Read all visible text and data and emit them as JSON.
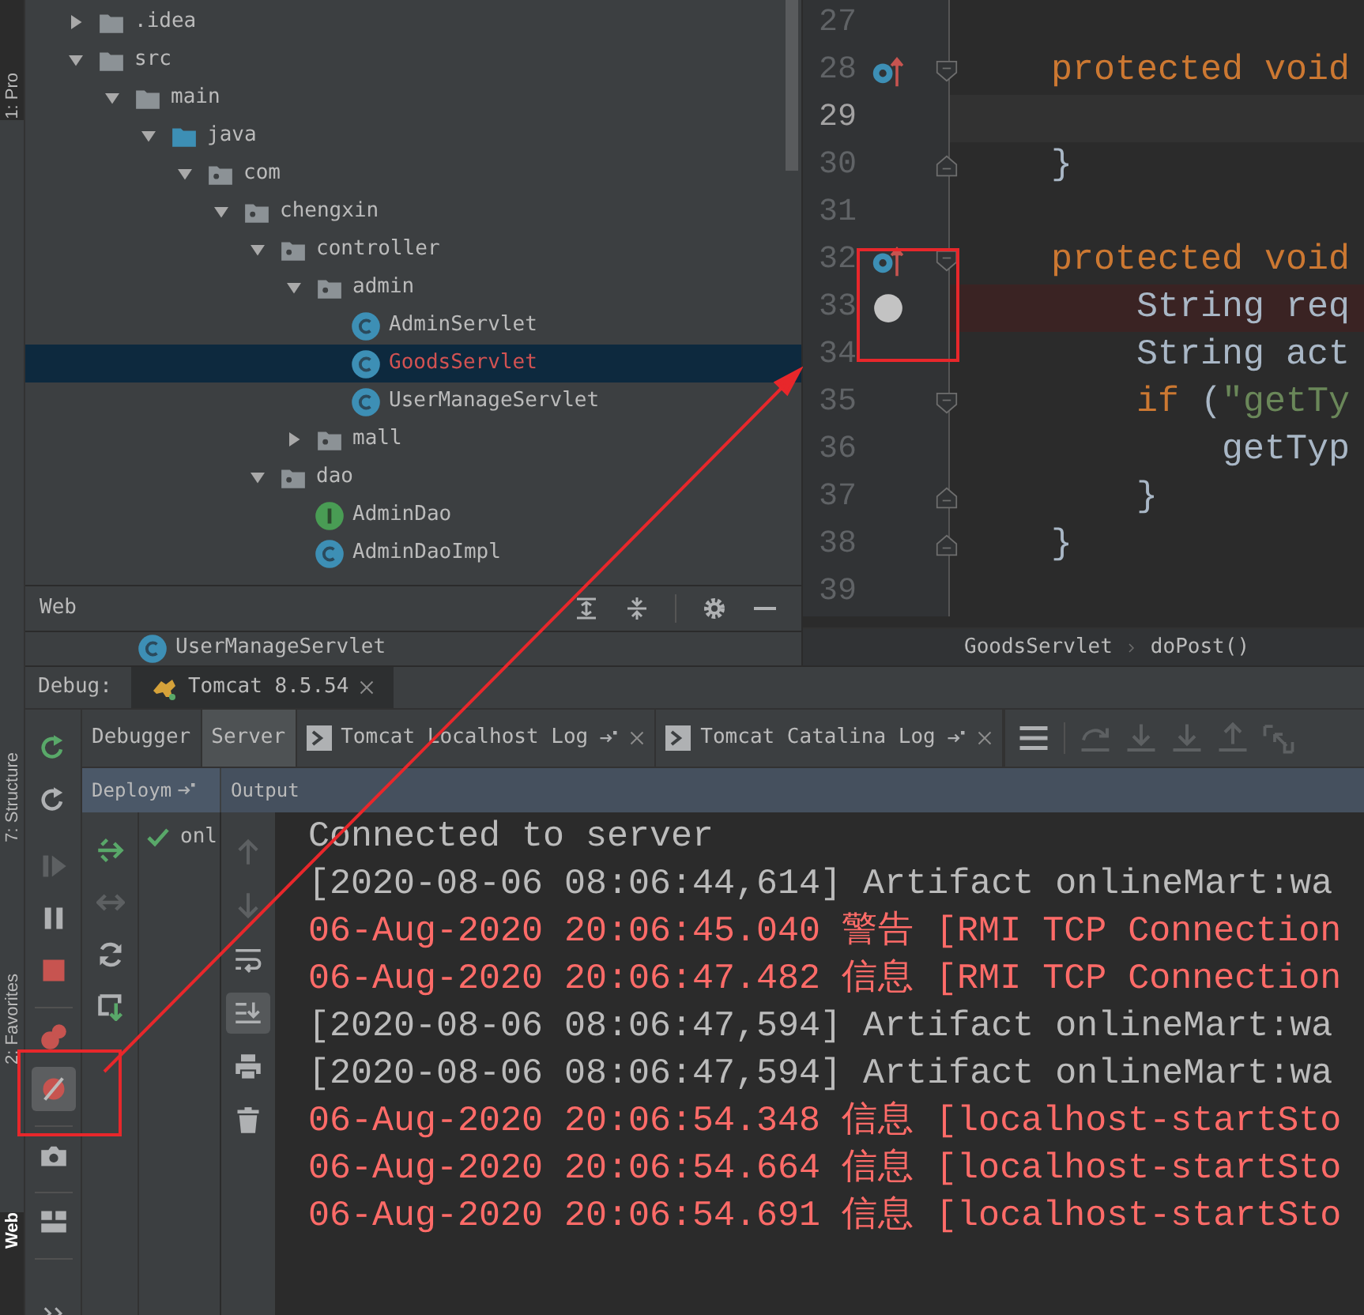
{
  "left_stripe": [
    {
      "label": "1: Pro",
      "selected": false
    },
    {
      "label": "7: Structure",
      "selected": false
    },
    {
      "label": "2: Favorites",
      "selected": false
    },
    {
      "label": "Web",
      "selected": true
    }
  ],
  "project_tree": [
    {
      "kind": "folder",
      "label": ".idea",
      "expanded": false,
      "selected": false
    },
    {
      "kind": "folder",
      "label": "src",
      "expanded": true,
      "selected": false,
      "children": [
        {
          "kind": "folder",
          "label": "main",
          "expanded": true,
          "selected": false,
          "children": [
            {
              "kind": "source_folder",
              "label": "java",
              "expanded": true,
              "selected": false,
              "children": [
                {
                  "kind": "package",
                  "label": "com",
                  "expanded": true,
                  "selected": false,
                  "children": [
                    {
                      "kind": "package",
                      "label": "chengxin",
                      "expanded": true,
                      "selected": false,
                      "children": [
                        {
                          "kind": "package",
                          "label": "controller",
                          "expanded": true,
                          "selected": false,
                          "children": [
                            {
                              "kind": "package",
                              "label": "admin",
                              "expanded": true,
                              "selected": false,
                              "children": [
                                {
                                  "kind": "class",
                                  "label": "AdminServlet",
                                  "selected": false,
                                  "color": "#bbbbbb"
                                },
                                {
                                  "kind": "class",
                                  "label": "GoodsServlet",
                                  "selected": true,
                                  "color": "#d25252"
                                },
                                {
                                  "kind": "class",
                                  "label": "UserManageServlet",
                                  "selected": false,
                                  "color": "#bbbbbb"
                                }
                              ]
                            },
                            {
                              "kind": "package",
                              "label": "mall",
                              "expanded": false,
                              "selected": false
                            }
                          ]
                        },
                        {
                          "kind": "package",
                          "label": "dao",
                          "expanded": true,
                          "selected": false,
                          "children": [
                            {
                              "kind": "interface",
                              "label": "AdminDao",
                              "selected": false,
                              "color": "#bbbbbb"
                            },
                            {
                              "kind": "class",
                              "label": "AdminDaoImpl",
                              "selected": false,
                              "color": "#bbbbbb"
                            }
                          ]
                        }
                      ]
                    }
                  ]
                }
              ]
            }
          ]
        }
      ]
    }
  ],
  "web_panel": {
    "title": "Web",
    "items": [
      {
        "kind": "class",
        "label": "UserManageServlet"
      }
    ]
  },
  "editor": {
    "lines": [
      {
        "number": "27",
        "current": false,
        "breakpoint_line": false
      },
      {
        "number": "28",
        "current": false,
        "breakpoint_line": false,
        "gutter_icons": [
          {
            "kind": "override"
          },
          {
            "kind": "fold_start"
          }
        ],
        "tokens": [
          {
            "text": "    protected void",
            "kind": "keyword"
          }
        ]
      },
      {
        "number": "29",
        "current": true,
        "breakpoint_line": false
      },
      {
        "number": "30",
        "current": false,
        "breakpoint_line": false,
        "gutter_icons": [
          {
            "kind": "fold_end"
          }
        ],
        "tokens": [
          {
            "text": "    }",
            "kind": "plain"
          }
        ]
      },
      {
        "number": "31",
        "current": false,
        "breakpoint_line": false
      },
      {
        "number": "32",
        "current": false,
        "breakpoint_line": false,
        "gutter_icons": [
          {
            "kind": "override"
          },
          {
            "kind": "fold_start"
          }
        ],
        "tokens": [
          {
            "text": "    protected void",
            "kind": "keyword"
          }
        ]
      },
      {
        "number": "33",
        "current": false,
        "breakpoint_line": true,
        "gutter_icons": [
          {
            "kind": "breakpoint",
            "muted": true
          }
        ],
        "tokens": [
          {
            "text": "        String req",
            "kind": "plain"
          }
        ]
      },
      {
        "number": "34",
        "current": false,
        "breakpoint_line": false,
        "tokens": [
          {
            "text": "        String act",
            "kind": "plain"
          }
        ]
      },
      {
        "number": "35",
        "current": false,
        "breakpoint_line": false,
        "gutter_icons": [
          {
            "kind": "fold_start"
          }
        ],
        "tokens": [
          {
            "text": "        if",
            "kind": "keyword"
          },
          {
            "text": " (",
            "kind": "plain"
          },
          {
            "text": "\"getTy",
            "kind": "string"
          }
        ]
      },
      {
        "number": "36",
        "current": false,
        "breakpoint_line": false,
        "tokens": [
          {
            "text": "            getTyp",
            "kind": "plain"
          }
        ]
      },
      {
        "number": "37",
        "current": false,
        "breakpoint_line": false,
        "gutter_icons": [
          {
            "kind": "fold_end"
          }
        ],
        "tokens": [
          {
            "text": "        }",
            "kind": "plain"
          }
        ]
      },
      {
        "number": "38",
        "current": false,
        "breakpoint_line": false,
        "gutter_icons": [
          {
            "kind": "fold_end"
          }
        ],
        "tokens": [
          {
            "text": "    }",
            "kind": "plain"
          }
        ]
      },
      {
        "number": "39",
        "current": false,
        "breakpoint_line": false
      }
    ],
    "breadcrumbs": [
      "GoodsServlet",
      "doPost()"
    ]
  },
  "debug": {
    "label": "Debug:",
    "session_tab": "Tomcat 8.5.54",
    "tabs": [
      {
        "label": "Debugger",
        "kind": "plain",
        "selected": false
      },
      {
        "label": "Server",
        "kind": "plain",
        "selected": true
      },
      {
        "label": "Tomcat Localhost Log",
        "kind": "log",
        "selected": false
      },
      {
        "label": "Tomcat Catalina Log",
        "kind": "log",
        "selected": false
      }
    ],
    "tab_toolbar": [
      {
        "kind": "menu",
        "disabled": false
      },
      {
        "kind": "step_over",
        "disabled": true
      },
      {
        "kind": "step_into",
        "disabled": true
      },
      {
        "kind": "step_into",
        "disabled": true
      },
      {
        "kind": "step_out",
        "disabled": true
      },
      {
        "kind": "drop_frame",
        "disabled": true
      }
    ],
    "sub_tabs": [
      {
        "label": "Deploym",
        "pinned": true
      },
      {
        "label": "Output",
        "pinned": false
      }
    ],
    "side_toolbar": [
      [
        {
          "kind": "rerun",
          "on": false,
          "disabled": false
        },
        {
          "kind": "restart",
          "on": false,
          "disabled": false
        }
      ],
      [
        {
          "kind": "resume",
          "on": false,
          "disabled": true
        },
        {
          "kind": "pause",
          "on": false,
          "disabled": false
        },
        {
          "kind": "stop",
          "on": false,
          "disabled": false
        }
      ],
      [
        {
          "kind": "breakpoints",
          "on": false,
          "disabled": false
        },
        {
          "kind": "mute_breakpoints",
          "on": true,
          "disabled": false
        }
      ],
      [
        {
          "kind": "camera",
          "on": false,
          "disabled": false
        }
      ],
      [
        {
          "kind": "layout",
          "on": false,
          "disabled": false
        }
      ],
      [
        {
          "kind": "more",
          "on": false,
          "disabled": false
        }
      ]
    ],
    "deploy_toolbar": [
      {
        "kind": "deploy",
        "disabled": false
      },
      {
        "kind": "undeploy",
        "disabled": true
      },
      {
        "kind": "refresh",
        "disabled": false
      },
      {
        "kind": "deploy_down",
        "disabled": false
      }
    ],
    "deployments": [
      {
        "label": "onl",
        "ok": true
      }
    ],
    "console_toolbar": [
      {
        "kind": "up",
        "on": false,
        "disabled": true
      },
      {
        "kind": "down",
        "on": false,
        "disabled": true
      },
      {
        "kind": "wrap",
        "on": false,
        "disabled": false
      },
      {
        "kind": "scroll_end",
        "on": true,
        "disabled": false
      },
      {
        "kind": "print",
        "on": false,
        "disabled": false
      },
      {
        "kind": "trash",
        "on": false,
        "disabled": false
      }
    ],
    "console": [
      {
        "text": "Connected to server",
        "kind": "info"
      },
      {
        "text": "[2020-08-06 08:06:44,614] Artifact onlineMart:wa",
        "kind": "info"
      },
      {
        "text": "06-Aug-2020 20:06:45.040 警告 [RMI TCP Connection",
        "kind": "error"
      },
      {
        "text": "06-Aug-2020 20:06:47.482 信息 [RMI TCP Connection",
        "kind": "error"
      },
      {
        "text": "[2020-08-06 08:06:47,594] Artifact onlineMart:wa",
        "kind": "info"
      },
      {
        "text": "[2020-08-06 08:06:47,594] Artifact onlineMart:wa",
        "kind": "info"
      },
      {
        "text": "06-Aug-2020 20:06:54.348 信息 [localhost-startSto",
        "kind": "error"
      },
      {
        "text": "06-Aug-2020 20:06:54.664 信息 [localhost-startSto",
        "kind": "error"
      },
      {
        "text": "06-Aug-2020 20:06:54.691 信息 [localhost-startSto",
        "kind": "error"
      }
    ]
  },
  "annotations": [
    {
      "kind": "box"
    },
    {
      "kind": "box"
    },
    {
      "kind": "arrow"
    }
  ]
}
